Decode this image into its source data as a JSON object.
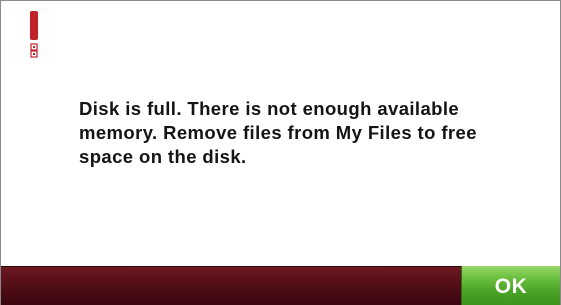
{
  "dialog": {
    "icon": "exclamation-alert-icon",
    "message": "Disk is full. There is not enough available memory. Remove files from My Files to free space on the disk.",
    "ok_label": "OK"
  },
  "colors": {
    "alert_red": "#c0222c",
    "footer_bar": "#4e0c14",
    "ok_green": "#5cb232",
    "text": "#141414"
  }
}
